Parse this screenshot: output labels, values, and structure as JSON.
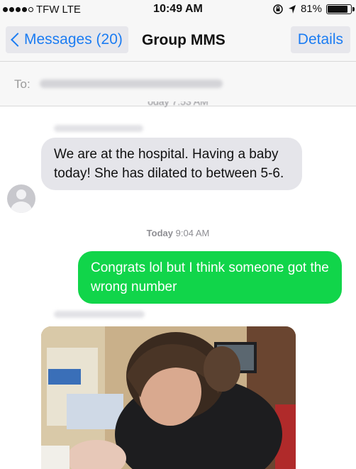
{
  "status_bar": {
    "carrier": "TFW",
    "network": "LTE",
    "time": "10:49 AM",
    "battery": "81%",
    "signal_bars_filled": 4,
    "signal_bars_total": 5,
    "battery_level": 0.81
  },
  "nav": {
    "back_label": "Messages (20)",
    "title": "Group MMS",
    "details_label": "Details"
  },
  "to_field": {
    "label": "To:"
  },
  "messages": {
    "top_timestamp_partial": "oday 7:53 AM",
    "incoming_text": "We are at the hospital. Having a baby today! She has dilated to between 5-6.",
    "timestamp_day": "Today",
    "timestamp_time": "9:04 AM",
    "outgoing_text": "Congrats lol but I think someone got the wrong number"
  },
  "colors": {
    "ios_blue": "#1b7cf2",
    "outgoing_green": "#11d54a",
    "incoming_gray": "#e5e5ea",
    "bar_gray": "#f7f7f7"
  }
}
